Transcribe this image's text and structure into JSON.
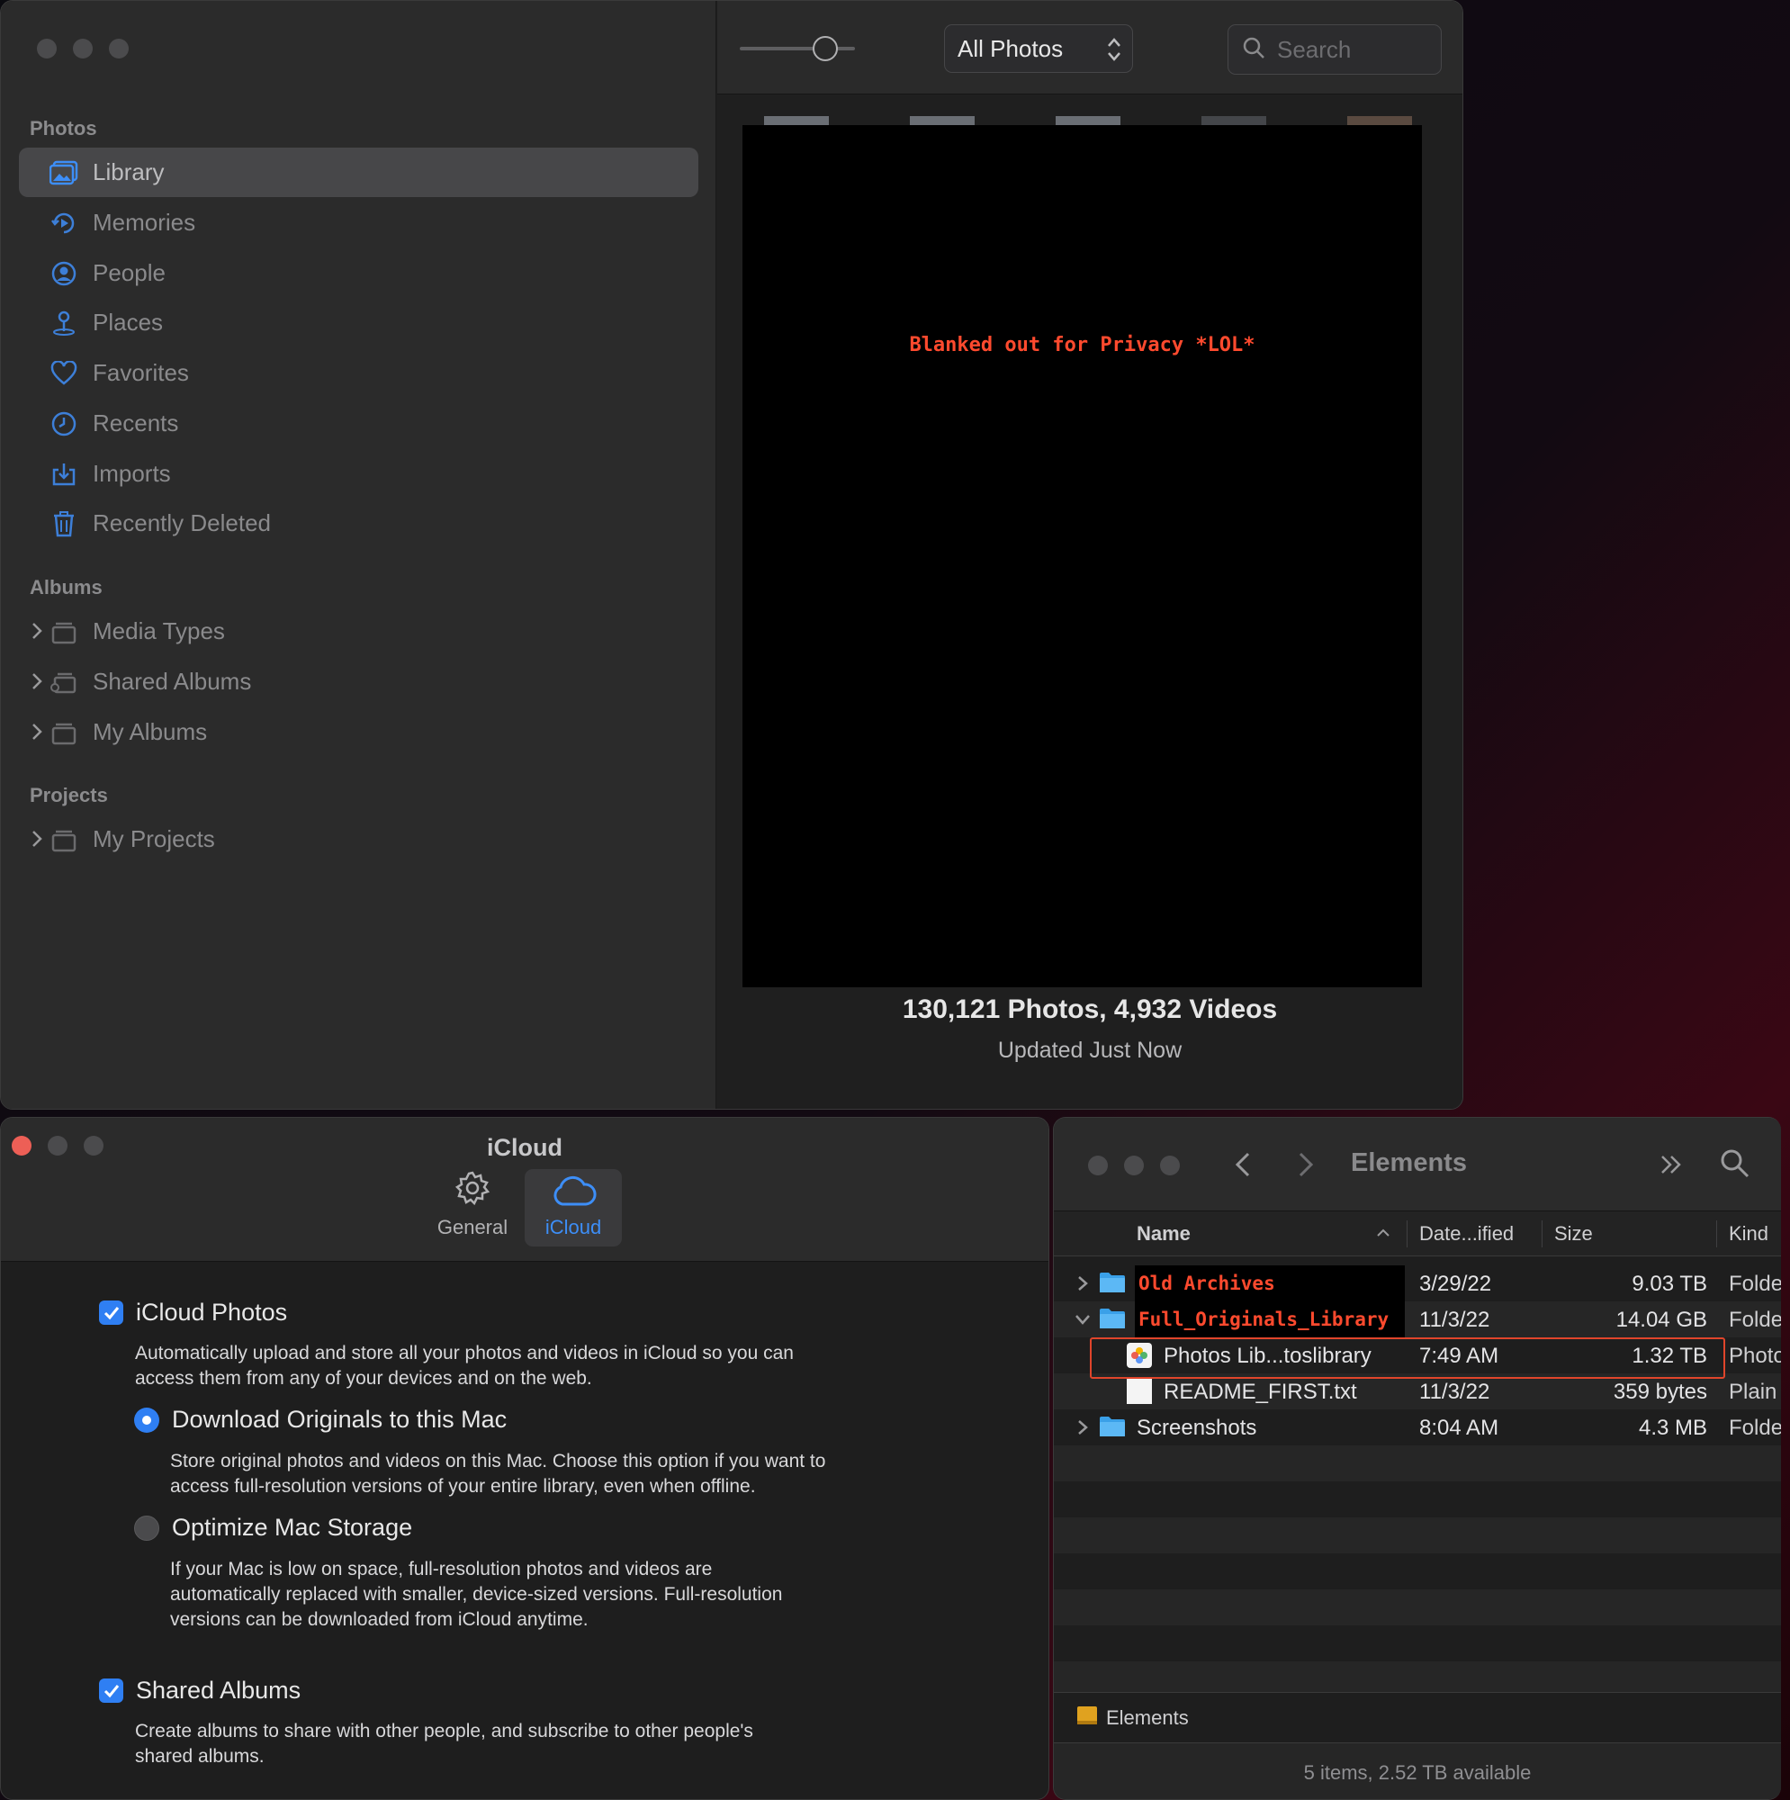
{
  "photos": {
    "sidebar": {
      "sections": {
        "photos": "Photos",
        "albums": "Albums",
        "projects": "Projects"
      },
      "items": [
        {
          "label": "Library"
        },
        {
          "label": "Memories"
        },
        {
          "label": "People"
        },
        {
          "label": "Places"
        },
        {
          "label": "Favorites"
        },
        {
          "label": "Recents"
        },
        {
          "label": "Imports"
        },
        {
          "label": "Recently Deleted"
        }
      ],
      "albums": [
        {
          "label": "Media Types"
        },
        {
          "label": "Shared Albums"
        },
        {
          "label": "My Albums"
        }
      ],
      "projects": [
        {
          "label": "My Projects"
        }
      ]
    },
    "toolbar": {
      "view_selector": "All Photos",
      "search_placeholder": "Search"
    },
    "privacy_note": "Blanked out for Privacy *LOL*",
    "summary": "130,121 Photos, 4,932 Videos",
    "status": "Updated Just Now"
  },
  "icloud": {
    "title": "iCloud",
    "tabs": [
      {
        "label": "General"
      },
      {
        "label": "iCloud"
      }
    ],
    "icloud_photos": {
      "label": "iCloud Photos",
      "checked": true,
      "desc_lines": [
        "Automatically upload and store all your photos and videos in iCloud so you can",
        "access them from any of your devices and on the web."
      ]
    },
    "download_originals": {
      "label": "Download Originals to this Mac",
      "selected": true,
      "desc_lines": [
        "Store original photos and videos on this Mac. Choose this option if you want to",
        "access full-resolution versions of your entire library, even when offline."
      ]
    },
    "optimize_storage": {
      "label": "Optimize Mac Storage",
      "selected": false,
      "desc_lines": [
        "If your Mac is low on space, full-resolution photos and videos are",
        "automatically replaced with smaller, device-sized versions. Full-resolution",
        "versions can be downloaded from iCloud anytime."
      ]
    },
    "shared_albums": {
      "label": "Shared Albums",
      "checked": true,
      "desc_lines": [
        "Create albums to share with other people, and subscribe to other people's",
        "shared albums."
      ]
    }
  },
  "finder": {
    "title": "Elements",
    "columns": {
      "name": "Name",
      "date": "Date...ified",
      "size": "Size",
      "kind": "Kind"
    },
    "rows": [
      {
        "name": "Old Archives",
        "date": "3/29/22",
        "size": "9.03 TB",
        "kind": "Folde"
      },
      {
        "name": "Full_Originals_Library",
        "date": "11/3/22",
        "size": "14.04 GB",
        "kind": "Folde"
      },
      {
        "name": "Photos Lib...toslibrary",
        "date": "7:49 AM",
        "size": "1.32 TB",
        "kind": "Photo"
      },
      {
        "name": "README_FIRST.txt",
        "date": "11/3/22",
        "size": "359 bytes",
        "kind": "Plain"
      },
      {
        "name": "Screenshots",
        "date": "8:04 AM",
        "size": "4.3 MB",
        "kind": "Folde"
      }
    ],
    "path": "Elements",
    "status": "5 items, 2.52 TB available"
  }
}
